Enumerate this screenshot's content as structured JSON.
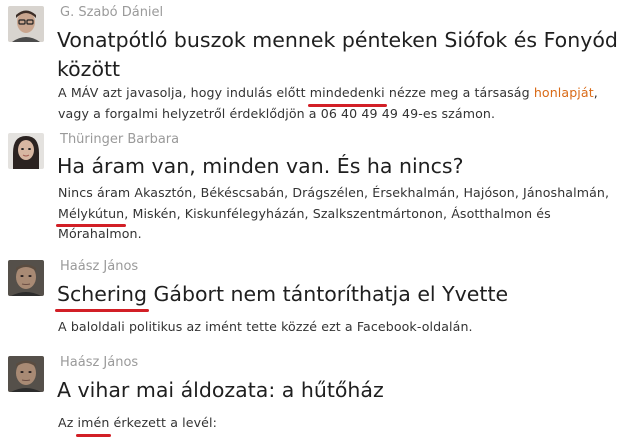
{
  "articles": [
    {
      "author": "G. Szabó Dániel",
      "title_line1": "Vonatpótló buszok mennek pénteken Siófok és Fonyód",
      "title_line2": "között",
      "body_before": "A MÁV azt javasolja, hogy indulás előtt ",
      "body_marked": "mindedenki",
      "body_middle": " nézze meg a társaság ",
      "body_link": "honlapját",
      "body_after": ",",
      "body_line2": "vagy a forgalmi helyzetről érdeklődjön a 06 40 49 49 49-es számon."
    },
    {
      "author": "Thüringer Barbara",
      "title": "Ha áram van, minden van. És ha nincs?",
      "body_line1": "Nincs áram Akasztón, Békéscsabán, Drágszélen, Érsekhalmán, Hajóson, Jánoshalmán,",
      "body_marked": "Mélykútun",
      "body_line2_rest": ", Miskén, Kiskunfélegyházán, Szalkszentmártonon, Ásotthalmon és",
      "body_line3": "Mórahalmon."
    },
    {
      "author": "Haász János",
      "title_marked": "Schering",
      "title_rest": " Gábort nem tántoríthatja el Yvette",
      "body": "A baloldali politikus az imént tette közzé ezt a Facebook-oldalán."
    },
    {
      "author": "Haász János",
      "title": "A vihar mai áldozata: a hűtőház",
      "body_before": "Az ",
      "body_marked": "imén",
      "body_after": " érkezett a levél:"
    }
  ],
  "colors": {
    "author": "#9a9a9a",
    "link": "#d96a17",
    "underline": "#d21f26"
  }
}
